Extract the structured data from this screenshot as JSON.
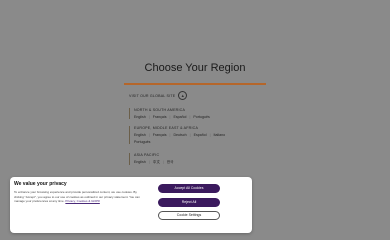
{
  "heading": "Choose Your Region",
  "visit_global": "VISIT OUR GLOBAL SITE",
  "regions": [
    {
      "title": "NORTH & SOUTH AMERICA",
      "languages": [
        "English",
        "Français",
        "Español",
        "Português"
      ]
    },
    {
      "title": "EUROPE, MIDDLE EAST & AFRICA",
      "languages": [
        "English",
        "Français",
        "Deutsch",
        "Español",
        "Italiano"
      ],
      "languages2": [
        "Português"
      ]
    },
    {
      "title": "ASIA PACIFIC",
      "languages": [
        "English",
        "中文",
        "한국"
      ]
    }
  ],
  "cookie": {
    "title": "We value your privacy",
    "text": "To enhance your browsing experience and provide personalized content, we use cookies. By clicking \"Accept\", you agree to our use of cookies as outlined in our privacy statement. You can manage your preferences at any time.",
    "link": "Privacy, Cookies & GDPR",
    "accept": "Accept All Cookies",
    "reject": "Reject All",
    "settings": "Cookie Settings"
  }
}
